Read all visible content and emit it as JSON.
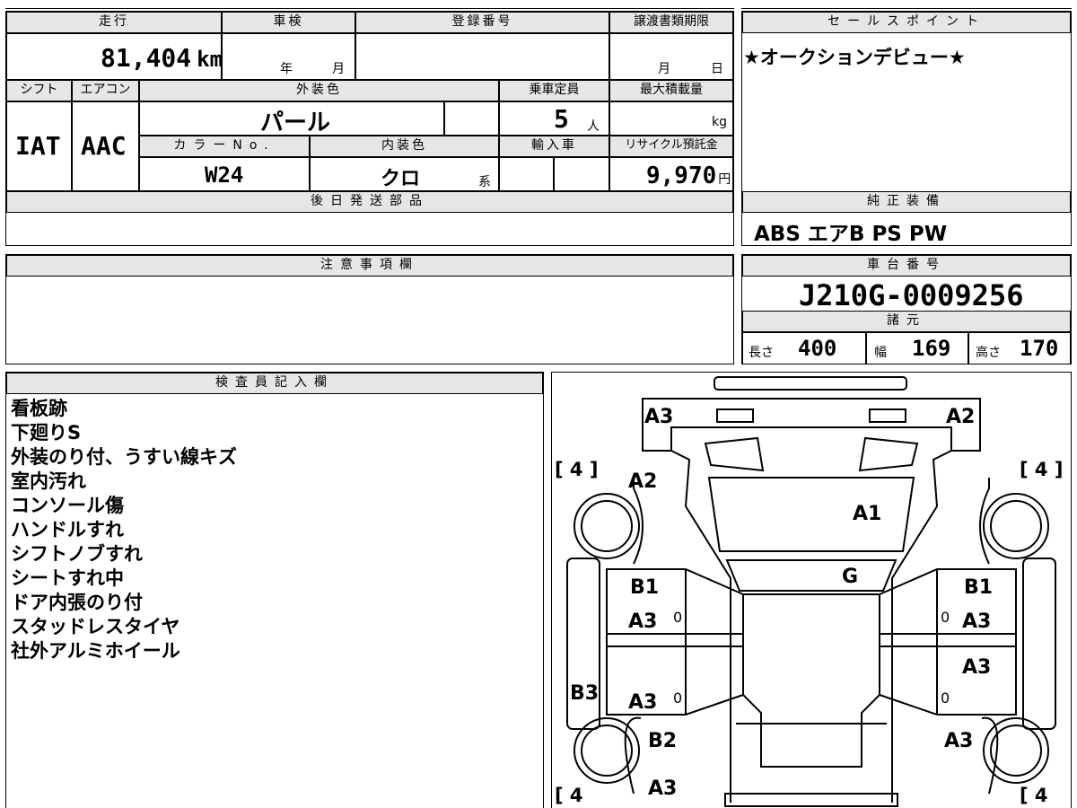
{
  "header": {
    "mileage_label": "走行",
    "mileage_value": "81,404",
    "mileage_unit": "km",
    "inspection_label": "車検",
    "year_unit": "年",
    "month_unit": "月",
    "registration_label": "登録番号",
    "transfer_deadline_label": "譲渡書類期限",
    "month_unit2": "月",
    "day_unit": "日"
  },
  "row2": {
    "shift_label": "シフト",
    "shift_value": "IAT",
    "aircon_label": "エアコン",
    "aircon_value": "AAC",
    "exterior_color_label": "外装色",
    "exterior_color_value": "パール",
    "capacity_label": "乗車定員",
    "capacity_value": "5",
    "capacity_unit": "人",
    "max_load_label": "最大積載量",
    "max_load_unit": "kg",
    "color_no_label": "カラーNo.",
    "color_no_value": "W24",
    "interior_color_label": "内装色",
    "interior_color_value": "クロ",
    "interior_suffix": "系",
    "import_label": "輸入車",
    "recycle_label": "リサイクル預託金",
    "recycle_value": "9,970",
    "recycle_unit": "円"
  },
  "later_parts_label": "後日発送部品",
  "sales_point": {
    "label": "セールスポイント",
    "text": "★オークションデビュー★"
  },
  "equipment": {
    "label": "純正装備",
    "value": "ABS エアB PS PW"
  },
  "caution_label": "注意事項欄",
  "chassis": {
    "label": "車台番号",
    "value": "J210G-0009256"
  },
  "specs": {
    "label": "諸元",
    "length_label": "長さ",
    "length_value": "400",
    "width_label": "幅",
    "width_value": "169",
    "height_label": "高さ",
    "height_value": "170"
  },
  "inspector": {
    "label": "検査員記入欄",
    "lines": [
      "看板跡",
      "下廻りS",
      "外装のり付、うすい線キズ",
      "室内汚れ",
      "コンソール傷",
      "ハンドルすれ",
      "シフトノブすれ",
      "シートすれ中",
      "ドア内張のり付",
      "スタッドレスタイヤ",
      "社外アルミホイール"
    ]
  },
  "diagram": {
    "front_left_code": "A3",
    "front_right_code": "A2",
    "hood_left_code": "A2",
    "windshield_code": "A1",
    "glass_code": "G",
    "left_front_door_1": "B1",
    "left_front_door_2": "A3",
    "right_front_door_1": "B1",
    "right_front_door_2": "A3",
    "left_rear_door": "A3",
    "right_rear_door": "A3",
    "left_sill": "B3",
    "left_rear_fender": "B2",
    "right_rear_fender": "A3",
    "rear_left": "A3",
    "tire_fl": "[ 4 ]",
    "tire_fr": "[ 4 ]",
    "tire_rl": "[ 4 ",
    "tire_rr": "[ 4",
    "zero1": "0",
    "zero2": "0",
    "zero3": "0",
    "zero4": "0"
  }
}
